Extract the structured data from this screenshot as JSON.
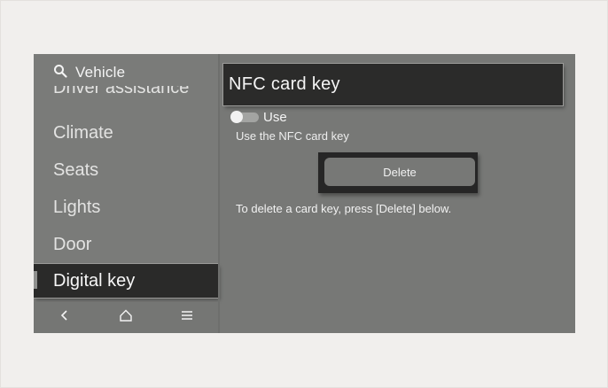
{
  "sidebar": {
    "search_label": "Vehicle",
    "items": [
      {
        "label": "Driver assistance",
        "state": "partially-scrolled"
      },
      {
        "label": "Climate"
      },
      {
        "label": "Seats"
      },
      {
        "label": "Lights"
      },
      {
        "label": "Door"
      },
      {
        "label": "Digital key",
        "selected": true
      }
    ]
  },
  "navbar": {
    "icons": [
      "back-icon",
      "home-icon",
      "menu-icon"
    ]
  },
  "main": {
    "title": "NFC card key",
    "toggle": {
      "label": "Use",
      "on": false,
      "description": "Use the NFC card key"
    },
    "delete_label": "Delete",
    "delete_hint": "To delete a card key, press [Delete] below."
  },
  "colors": {
    "page_bg": "#f1efed",
    "screen_bg": "#777876",
    "selected_bg": "#2a2a29",
    "text": "#f4f4f4"
  }
}
